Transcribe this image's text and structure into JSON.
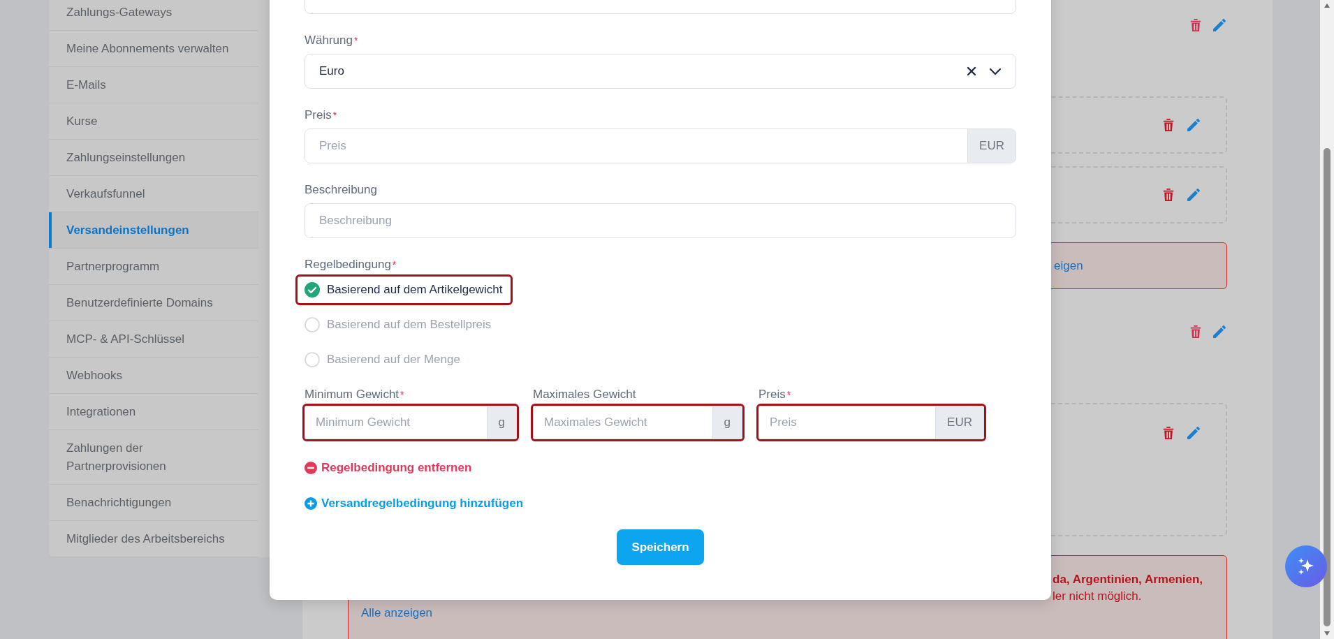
{
  "sidebar": {
    "items": [
      {
        "label": "Zahlungs-Gateways",
        "selected": false
      },
      {
        "label": "Meine Abonnements verwalten",
        "selected": false
      },
      {
        "label": "E-Mails",
        "selected": false
      },
      {
        "label": "Kurse",
        "selected": false
      },
      {
        "label": "Zahlungseinstellungen",
        "selected": false
      },
      {
        "label": "Verkaufsfunnel",
        "selected": false
      },
      {
        "label": "Versandeinstellungen",
        "selected": true
      },
      {
        "label": "Partnerprogramm",
        "selected": false
      },
      {
        "label": "Benutzerdefinierte Domains",
        "selected": false
      },
      {
        "label": "MCP- & API-Schlüssel",
        "selected": false
      },
      {
        "label": "Webhooks",
        "selected": false
      },
      {
        "label": "Integrationen",
        "selected": false
      },
      {
        "label": "Zahlungen der Partnerprovisionen",
        "selected": false
      },
      {
        "label": "Benachrichtigungen",
        "selected": false
      },
      {
        "label": "Mitglieder des Arbeitsbereichs",
        "selected": false
      }
    ]
  },
  "cards": [
    {
      "kind": "actions"
    },
    {
      "kind": "dashed"
    },
    {
      "kind": "dashed"
    },
    {
      "kind": "alert",
      "link": "eigen"
    },
    {
      "kind": "actions"
    },
    {
      "kind": "panel"
    },
    {
      "kind": "alert",
      "bold_text": "da, Argentinien, Armenien,",
      "text": "ler nicht möglich.",
      "link": "Alle anzeigen"
    }
  ],
  "modal": {
    "fields": [
      {
        "kind": "select",
        "label": "Währung",
        "required_mark": "*",
        "value": "Euro"
      },
      {
        "kind": "addon",
        "label": "Preis",
        "required_mark": "*",
        "placeholder": "Preis",
        "addon": "EUR"
      },
      {
        "kind": "text",
        "label": "Beschreibung",
        "placeholder": "Beschreibung"
      }
    ],
    "rule": {
      "label": "Regelbedingung",
      "required_mark": "*",
      "options": [
        {
          "label": "Basierend auf dem Artikelgewicht",
          "selected": true,
          "highlighted": true
        },
        {
          "label": "Basierend auf dem Bestellpreis",
          "selected": false,
          "highlighted": false
        },
        {
          "label": "Basierend auf der Menge",
          "selected": false,
          "highlighted": false
        }
      ]
    },
    "range_fields": [
      {
        "label": "Minimum Gewicht",
        "required_mark": "*",
        "placeholder": "Minimum Gewicht",
        "addon": "g",
        "highlighted": true
      },
      {
        "label": "Maximales Gewicht",
        "placeholder": "Maximales Gewicht",
        "addon": "g",
        "highlighted": true
      },
      {
        "label": "Preis",
        "required_mark": "*",
        "placeholder": "Preis",
        "addon": "EUR",
        "highlighted": true
      }
    ],
    "remove_link": "Regelbedingung entfernen",
    "add_link": "Versandregelbedingung hinzufügen",
    "save_button": "Speichern"
  }
}
